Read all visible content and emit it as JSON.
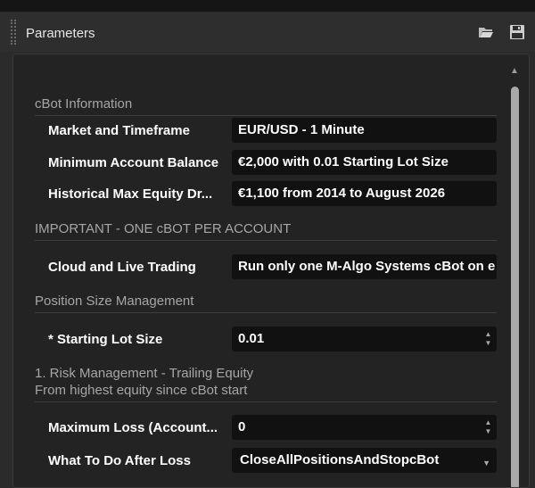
{
  "panel": {
    "title": "Parameters"
  },
  "groups": {
    "info": "cBot Information",
    "important": "IMPORTANT - ONE cBOT PER ACCOUNT",
    "position": "Position Size Management",
    "risk_line1": "1. Risk Management - Trailing Equity",
    "risk_line2": "From highest equity since cBot start"
  },
  "params": {
    "market_label": "Market and Timeframe",
    "market_value": "EUR/USD - 1 Minute",
    "balance_label": "Minimum Account Balance",
    "balance_value": "€2,000 with 0.01 Starting Lot Size",
    "drawdown_label": "Historical Max Equity Dr...",
    "drawdown_value": "€1,100 from 2014 to August 2026",
    "cloud_label": "Cloud and Live Trading",
    "cloud_value": "Run only one M-Algo Systems cBot on e",
    "lot_label": "* Starting Lot Size",
    "lot_value": "0.01",
    "maxloss_label": "Maximum Loss (Account...",
    "maxloss_value": "0",
    "afterloss_label": "What To Do After Loss",
    "afterloss_value": "CloseAllPositionsAndStopcBot"
  },
  "icons": {
    "open": "folder-open-icon",
    "save": "save-icon",
    "spin_up": "▲",
    "spin_down": "▼",
    "dropdown": "▼",
    "scroll_up": "▲"
  },
  "colors": {
    "background": "#2b2b2b",
    "field": "#111111",
    "group_text": "#a6a6a6"
  }
}
